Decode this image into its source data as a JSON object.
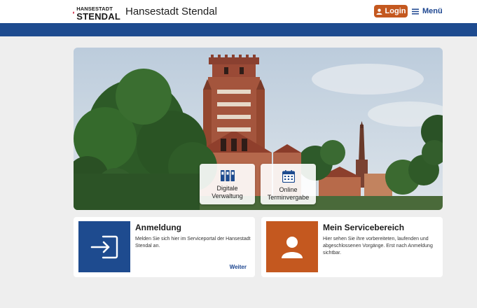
{
  "header": {
    "logo_small": "HANSESTADT",
    "logo_big": "STENDAL",
    "title": "Hansestadt Stendal",
    "login_label": "Login",
    "menu_label": "Menü"
  },
  "tiles": [
    {
      "line1": "Digitale",
      "line2": "Verwaltung",
      "icon": "archive-binders-icon"
    },
    {
      "line1": "Online",
      "line2": "Terminvergabe",
      "icon": "calendar-icon"
    }
  ],
  "cards": [
    {
      "title": "Anmeldung",
      "text": "Melden Sie sich hier im Serviceportal der Hansestadt Stendal an.",
      "link": "Weiter",
      "icon": "sign-in-icon"
    },
    {
      "title": "Mein Servicebereich",
      "text": "Hier sehen Sie ihre vorbereiteten, laufenden und abgeschlossenen Vorgänge. Erst nach Anmeldung sichtbar.",
      "icon": "user-icon"
    }
  ],
  "colors": {
    "primary_blue": "#1e4b8f",
    "accent_orange": "#c4581f",
    "background": "#eeeeee"
  }
}
